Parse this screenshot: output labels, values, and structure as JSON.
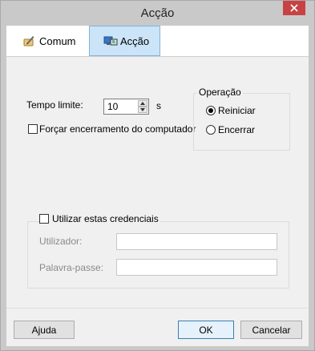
{
  "window": {
    "title": "Acção",
    "close_icon": "close-icon"
  },
  "tabs": [
    {
      "label": "Comum",
      "icon": "pen-scroll-icon",
      "selected": false
    },
    {
      "label": "Acção",
      "icon": "monitor-action-icon",
      "selected": true
    }
  ],
  "timeout": {
    "label": "Tempo limite:",
    "value": "10",
    "unit": "s"
  },
  "force_shutdown": {
    "label": "Forçar encerramento do computador",
    "checked": false
  },
  "operation": {
    "legend": "Operação",
    "options": [
      {
        "label": "Reiniciar",
        "selected": true
      },
      {
        "label": "Encerrar",
        "selected": false
      }
    ]
  },
  "credentials": {
    "checkbox_label": "Utilizar estas credenciais",
    "checked": false,
    "user_label": "Utilizador:",
    "user_value": "",
    "password_label": "Palavra-passe:",
    "password_value": ""
  },
  "footer": {
    "help_label": "Ajuda",
    "ok_label": "OK",
    "cancel_label": "Cancelar"
  },
  "colors": {
    "selected_tab": "#cce4f7",
    "close_button": "#c74343"
  }
}
